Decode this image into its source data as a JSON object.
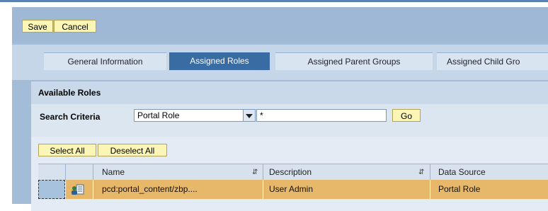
{
  "toolbar": {
    "save_label": "Save",
    "cancel_label": "Cancel"
  },
  "tabs": [
    {
      "label": "General Information",
      "active": false
    },
    {
      "label": "Assigned Roles",
      "active": true
    },
    {
      "label": "Assigned Parent Groups",
      "active": false
    },
    {
      "label": "Assigned Child Gro",
      "active": false
    }
  ],
  "available_roles": {
    "title": "Available Roles",
    "search_label": "Search Criteria",
    "search_type": "Portal Role",
    "search_value": "*",
    "go_label": "Go",
    "select_all_label": "Select All",
    "deselect_all_label": "Deselect All"
  },
  "table": {
    "columns": [
      "Name",
      "Description",
      "Data Source"
    ],
    "rows": [
      {
        "name": "pcd:portal_content/zbp....",
        "description": "User Admin",
        "data_source": "Portal Role",
        "icon": "role-icon"
      }
    ]
  },
  "colors": {
    "accent": "#3a6ca4",
    "button": "#fbf5b6",
    "selected_row": "#e8b86a"
  }
}
